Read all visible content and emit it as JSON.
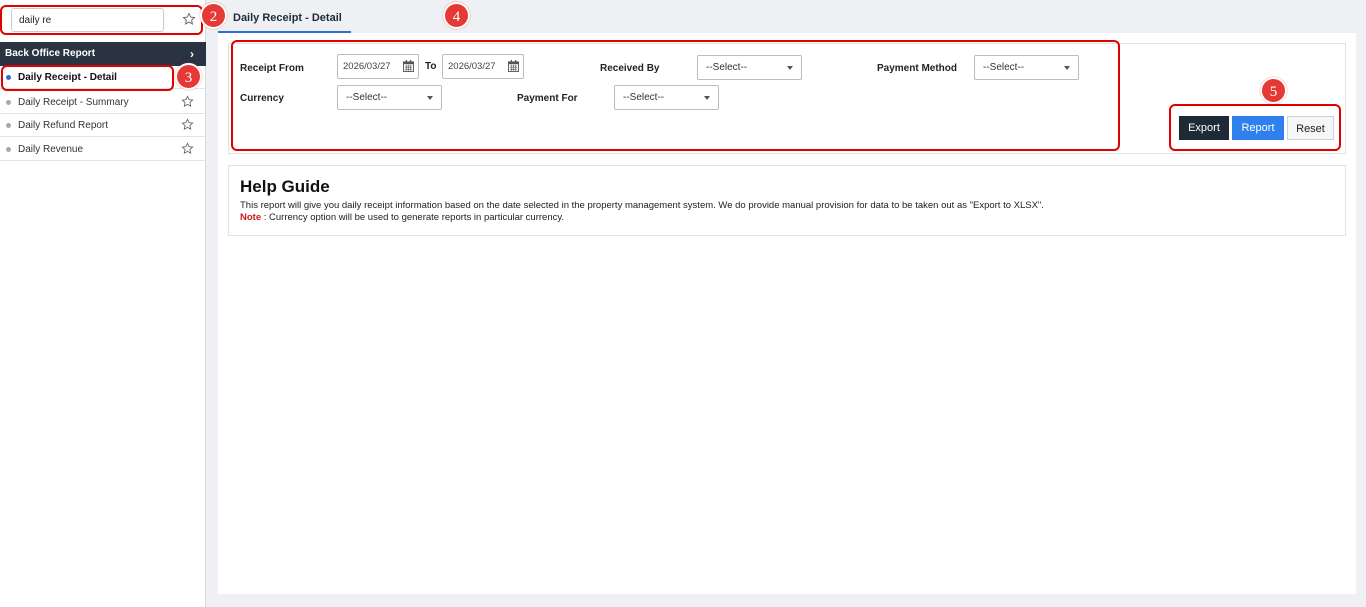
{
  "sidebar": {
    "search": {
      "value": "daily re",
      "placeholder": ""
    },
    "section_title": "Back Office Report",
    "items": [
      {
        "label": "Daily Receipt - Detail",
        "active": true
      },
      {
        "label": "Daily Receipt - Summary",
        "active": false
      },
      {
        "label": "Daily Refund Report",
        "active": false
      },
      {
        "label": "Daily Revenue",
        "active": false
      }
    ]
  },
  "tabs": [
    {
      "label": "Daily Receipt - Detail"
    }
  ],
  "filters": {
    "receipt_from_label": "Receipt From",
    "receipt_from_value": "2026/03/27",
    "to_label": "To",
    "to_value": "2026/03/27",
    "received_by_label": "Received By",
    "received_by_value": "--Select--",
    "payment_method_label": "Payment Method",
    "payment_method_value": "--Select--",
    "currency_label": "Currency",
    "currency_value": "--Select--",
    "payment_for_label": "Payment For",
    "payment_for_value": "--Select--"
  },
  "buttons": {
    "export": "Export",
    "report": "Report",
    "reset": "Reset"
  },
  "help": {
    "title": "Help Guide",
    "text": "This report will give you daily receipt information based on the date selected in the property management system. We do provide manual provision for data to be taken out as \"Export to XLSX\".",
    "note_label": "Note",
    "note_text": " : Currency option will be used to generate reports in particular currency."
  },
  "annotations": [
    "2",
    "3",
    "4",
    "5"
  ],
  "colors": {
    "accent": "#2f80ed",
    "header_dark": "#2a3342",
    "annotation_red": "#e00000",
    "note_red": "#cc1b1b"
  },
  "icons": [
    "star-icon",
    "chevron-right-icon",
    "calendar-icon",
    "caret-down-icon"
  ]
}
